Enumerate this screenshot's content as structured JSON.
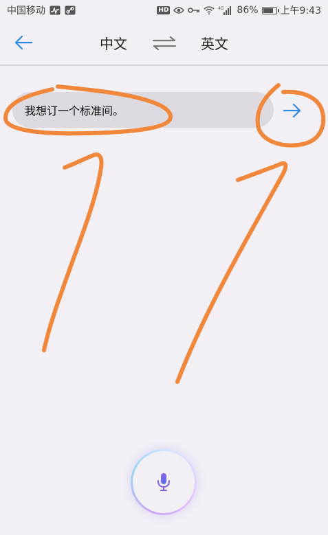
{
  "status_bar": {
    "carrier": "中国移动",
    "battery": "86%",
    "battery_level": 0.86,
    "time": "上午9:43",
    "hd_label": "HD",
    "network_label": "4G",
    "icons": [
      "activity-icon",
      "link-icon",
      "hd-icon",
      "eye-icon",
      "key-icon",
      "wifi-icon",
      "signal-icon",
      "battery-icon"
    ]
  },
  "top_bar": {
    "back_icon": "arrow-left-icon",
    "source_lang": "中文",
    "swap_icon": "swap-icon",
    "target_lang": "英文"
  },
  "input": {
    "text": "我想订一个标准间。",
    "send_icon": "arrow-right-icon"
  },
  "mic": {
    "icon": "microphone-icon"
  },
  "colors": {
    "accent": "#2d8ce8",
    "background": "#f2f0f5",
    "pill": "#dcdae0",
    "annotation": "#f0873a",
    "mic": "#7b5ce5"
  }
}
